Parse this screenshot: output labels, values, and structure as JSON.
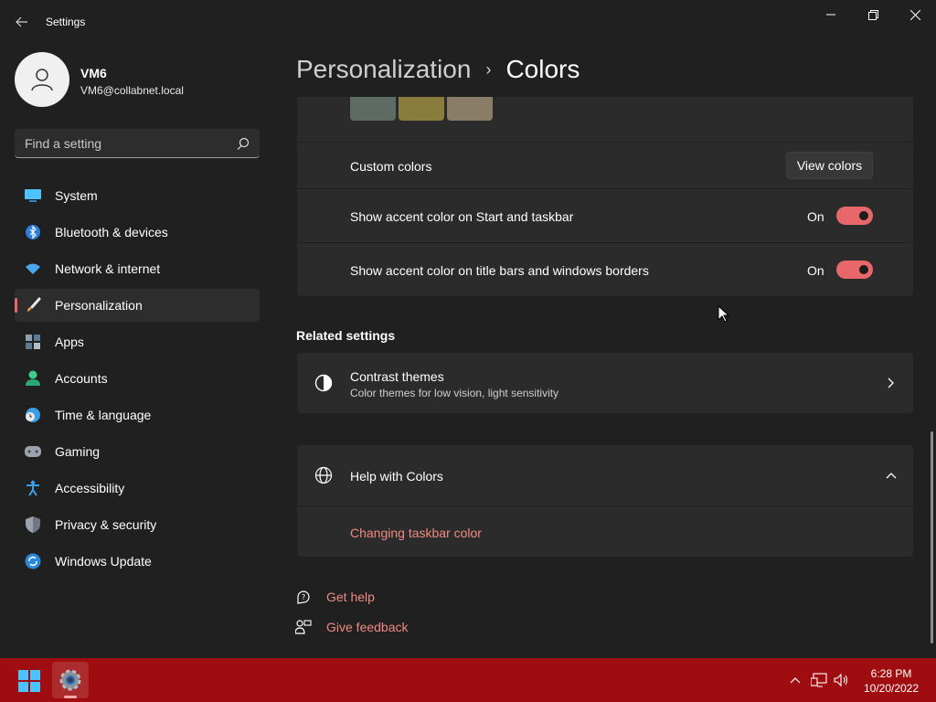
{
  "window": {
    "title": "Settings"
  },
  "user": {
    "name": "VM6",
    "email": "VM6@collabnet.local"
  },
  "search": {
    "placeholder": "Find a setting"
  },
  "sidebar": {
    "items": [
      {
        "label": "System",
        "icon": "system-icon",
        "active": false
      },
      {
        "label": "Bluetooth & devices",
        "icon": "bluetooth-icon",
        "active": false
      },
      {
        "label": "Network & internet",
        "icon": "wifi-icon",
        "active": false
      },
      {
        "label": "Personalization",
        "icon": "brush-icon",
        "active": true
      },
      {
        "label": "Apps",
        "icon": "apps-icon",
        "active": false
      },
      {
        "label": "Accounts",
        "icon": "accounts-icon",
        "active": false
      },
      {
        "label": "Time & language",
        "icon": "clock-globe-icon",
        "active": false
      },
      {
        "label": "Gaming",
        "icon": "gamepad-icon",
        "active": false
      },
      {
        "label": "Accessibility",
        "icon": "accessibility-icon",
        "active": false
      },
      {
        "label": "Privacy & security",
        "icon": "shield-icon",
        "active": false
      },
      {
        "label": "Windows Update",
        "icon": "update-icon",
        "active": false
      }
    ]
  },
  "breadcrumb": {
    "parent": "Personalization",
    "separator": "›",
    "current": "Colors"
  },
  "swatches": [
    "#5d6b64",
    "#8a7c3d",
    "#8a7d67"
  ],
  "colors": {
    "custom_colors_label": "Custom colors",
    "view_colors_button": "View colors",
    "accent_start_label": "Show accent color on Start and taskbar",
    "accent_start_state": "On",
    "accent_title_label": "Show accent color on title bars and windows borders",
    "accent_title_state": "On"
  },
  "related": {
    "title": "Related settings",
    "contrast_title": "Contrast themes",
    "contrast_sub": "Color themes for low vision, light sensitivity"
  },
  "help": {
    "title": "Help with Colors",
    "link": "Changing taskbar color"
  },
  "footer": {
    "get_help": "Get help",
    "give_feedback": "Give feedback"
  },
  "taskbar": {
    "time": "6:28 PM",
    "date": "10/20/2022"
  },
  "theme": {
    "accent": "#e8676b",
    "taskbar": "#a00d10",
    "link": "#f08a80"
  }
}
